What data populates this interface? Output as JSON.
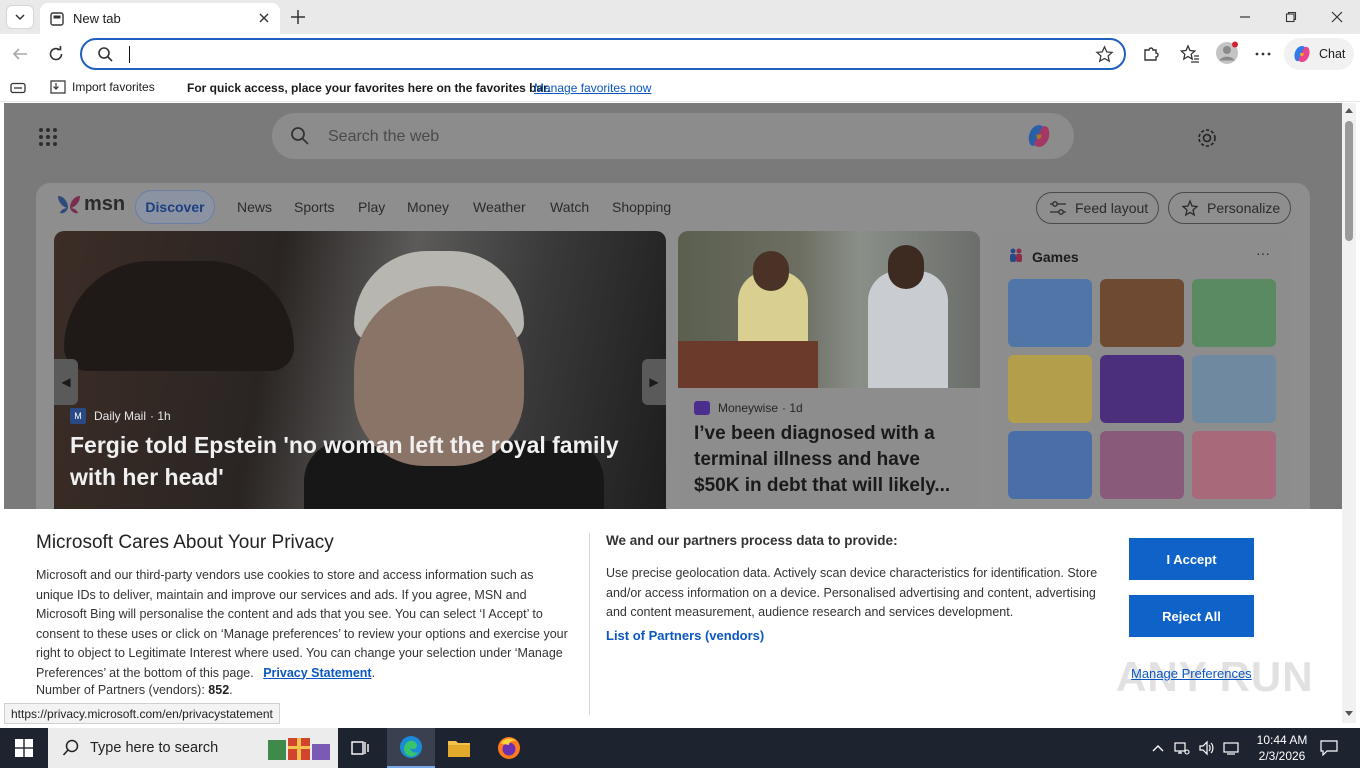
{
  "browser": {
    "tab_title": "New tab",
    "address_value": "",
    "chat_label": "Chat"
  },
  "favorites_bar": {
    "import_label": "Import favorites",
    "hint": "For quick access, place your favorites here on the favorites bar.",
    "manage_link": "Manage favorites now"
  },
  "newtab": {
    "search_placeholder": "Search the web"
  },
  "msn": {
    "logo_text": "msn",
    "nav": [
      "Discover",
      "News",
      "Sports",
      "Play",
      "Money",
      "Weather",
      "Watch",
      "Shopping"
    ],
    "feed_layout_label": "Feed layout",
    "personalize_label": "Personalize",
    "hero": {
      "source": "Daily Mail",
      "age": "· 1h",
      "headline": "Fergie told Epstein 'no woman left the royal family with her head'"
    },
    "card2": {
      "source": "Moneywise",
      "age": "· 1d",
      "headline": "I’ve been diagnosed with a terminal illness and have $50K in debt that will likely..."
    },
    "games": {
      "title": "Games",
      "more": "···"
    }
  },
  "privacy": {
    "title": "Microsoft Cares About Your Privacy",
    "body": "Microsoft and our third-party vendors use cookies to store and access information such as unique IDs to deliver, maintain and improve our services and ads. If you agree, MSN and Microsoft Bing will personalise the content and ads that you see. You can select ‘I Accept’ to consent to these uses or click on ‘Manage preferences’ to review your options and exercise your right to object to Legitimate Interest where used.  You can change your selection under ‘Manage Preferences’ at the bottom of this page.",
    "privacy_link": "Privacy Statement",
    "privacy_link_suffix": ".",
    "partners_count_label": "Number of Partners (vendors):",
    "partners_count": "852",
    "partners_count_suffix": ".",
    "purposes_title": "We and our partners process data to provide:",
    "purposes_text": "Use precise geolocation data. Actively scan device characteristics for identification. Store and/or access information on a device. Personalised advertising and content, advertising and content measurement, audience research and services development.",
    "partners_link": "List of Partners (vendors)",
    "accept_label": "I Accept",
    "reject_label": "Reject All",
    "manage_label": "Manage Preferences"
  },
  "status_url": "https://privacy.microsoft.com/en/privacystatement",
  "watermark": "ANY RUN",
  "taskbar": {
    "search_placeholder": "Type here to search",
    "time": "10:44 AM",
    "date": "2/3/2026"
  },
  "colors": {
    "accent": "#0f62c8",
    "link": "#0b57c2",
    "taskbar": "#1e2330"
  }
}
